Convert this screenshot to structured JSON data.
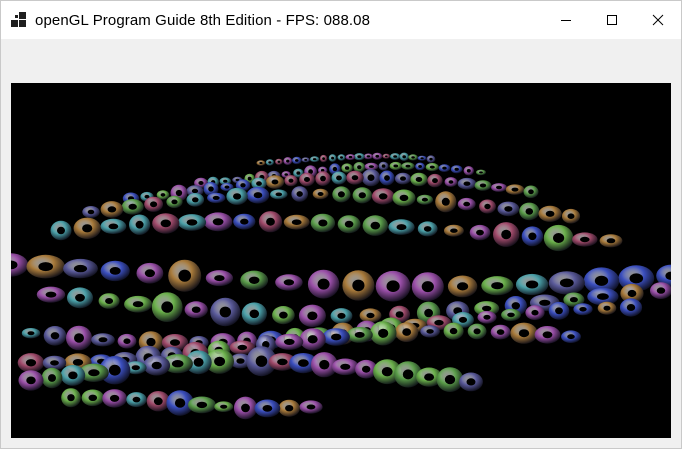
{
  "window": {
    "title": "openGL Program Guide 8th Edition - FPS: 088.08",
    "icon": "app-window-icon",
    "controls": [
      "minimize-icon",
      "maximize-icon",
      "close-icon"
    ]
  },
  "viewport": {
    "background": "#000000",
    "content": "3D scene of multicolored tori arranged in a wavy grid"
  },
  "colors": {
    "titlebar": "#ffffff",
    "frame": "#f0f0f0",
    "torus_palette": [
      "#3b4fbf",
      "#5b9e4a",
      "#9a4fa8",
      "#4aa0a8",
      "#a87a3a",
      "#5a5a9a",
      "#6ab04a",
      "#a04a6a"
    ]
  }
}
